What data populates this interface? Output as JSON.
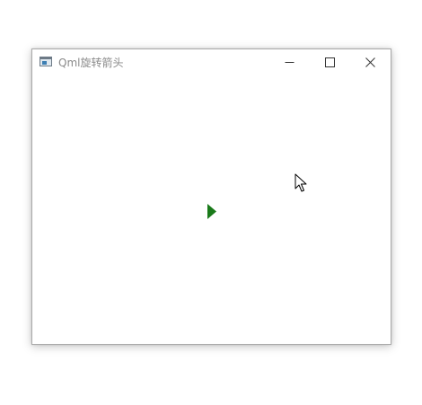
{
  "window": {
    "title": "Qml旋转箭头",
    "icon": "app-window-icon",
    "controls": {
      "minimize_icon": "minimize-icon",
      "maximize_icon": "maximize-icon",
      "close_icon": "close-icon"
    }
  },
  "content": {
    "arrow": {
      "icon": "triangle-arrow-right-icon",
      "color": "#1a7a1a"
    }
  },
  "pointer": {
    "icon": "mouse-pointer-icon"
  },
  "colors": {
    "background": "#ffffff",
    "window_border": "#a9a9a9",
    "title_text": "#8a8a8a"
  }
}
